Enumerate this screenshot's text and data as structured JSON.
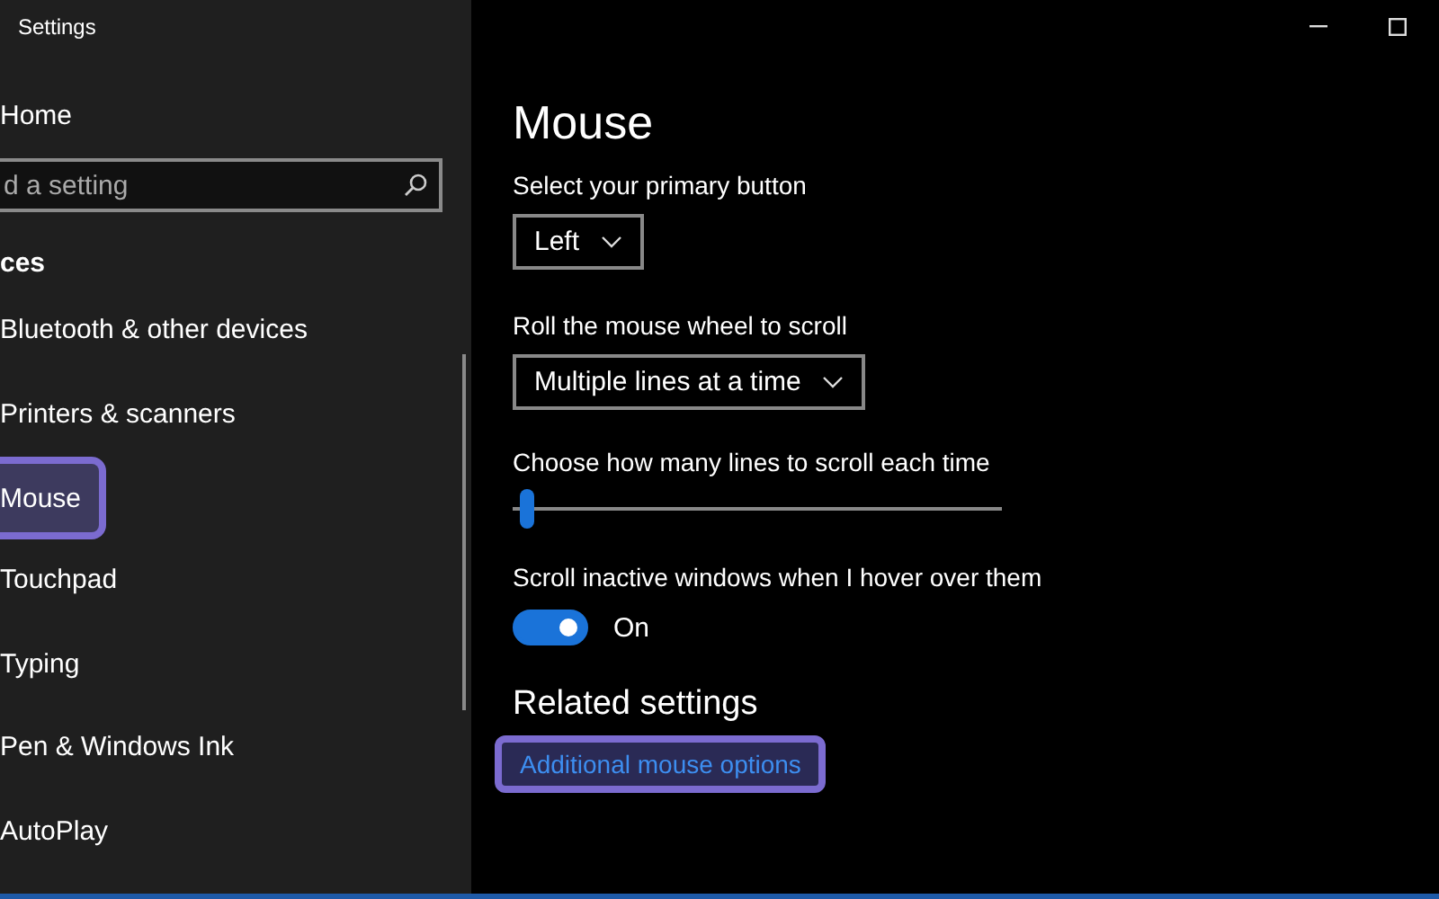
{
  "window": {
    "title": "Settings"
  },
  "sidebar": {
    "home": "Home",
    "search": {
      "placeholder": "d a setting"
    },
    "heading": "ces",
    "items": [
      {
        "label": "Bluetooth & other devices",
        "selected": false
      },
      {
        "label": "Printers & scanners",
        "selected": false
      },
      {
        "label": "Mouse",
        "selected": true
      },
      {
        "label": "Touchpad",
        "selected": false
      },
      {
        "label": "Typing",
        "selected": false
      },
      {
        "label": "Pen & Windows Ink",
        "selected": false
      },
      {
        "label": "AutoPlay",
        "selected": false
      }
    ]
  },
  "page": {
    "title": "Mouse",
    "primary_button": {
      "label": "Select your primary button",
      "value": "Left"
    },
    "wheel": {
      "label": "Roll the mouse wheel to scroll",
      "value": "Multiple lines at a time"
    },
    "lines": {
      "label": "Choose how many lines to scroll each time",
      "level": 0.03
    },
    "inactive": {
      "label": "Scroll inactive windows when I hover over them",
      "on": true,
      "state": "On"
    },
    "related": {
      "heading": "Related settings",
      "link": {
        "label": "Additional mouse options",
        "highlighted": true
      }
    }
  }
}
